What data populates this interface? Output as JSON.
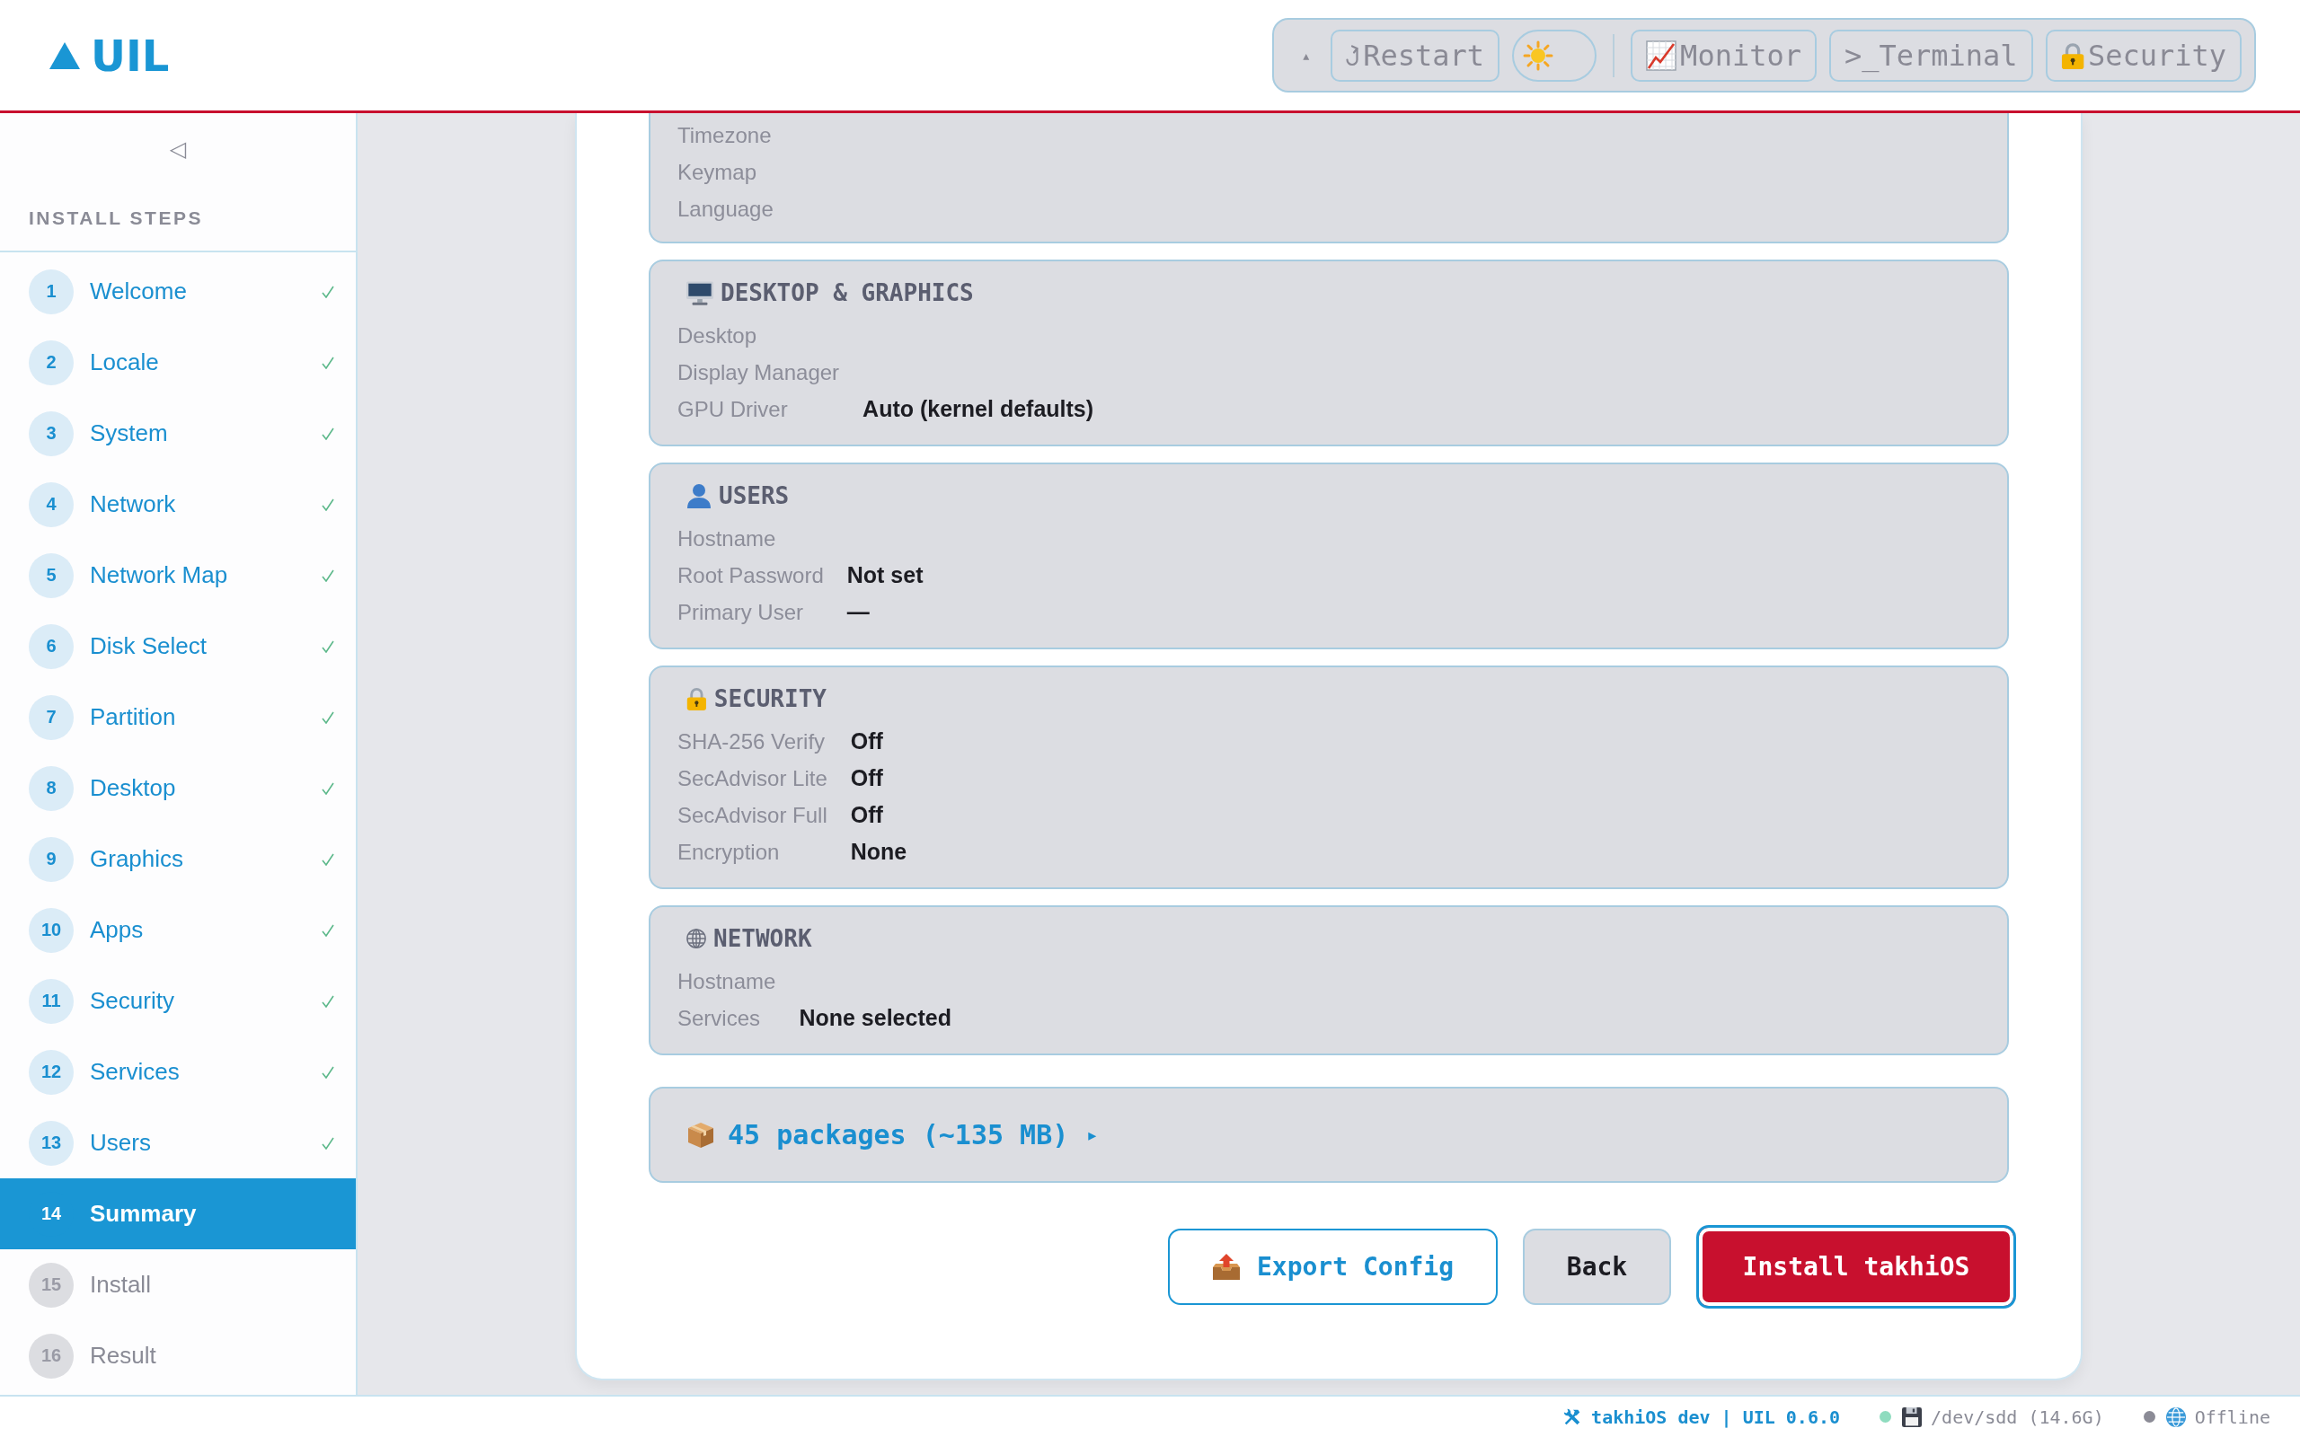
{
  "header": {
    "logo": "UIL",
    "toolbar": {
      "collapse_glyph": "▴",
      "items": [
        {
          "kind": "restart",
          "label": "Restart"
        },
        {
          "kind": "theme_toggle",
          "dark": false
        },
        {
          "kind": "separator"
        },
        {
          "kind": "monitor",
          "label": "Monitor"
        },
        {
          "kind": "terminal",
          "label": ">_Terminal"
        },
        {
          "kind": "security",
          "label": "Security"
        }
      ]
    }
  },
  "sidebar": {
    "collapse_glyph": "◁",
    "title": "INSTALL STEPS",
    "steps": [
      {
        "number": "1",
        "label": "Welcome",
        "done": true,
        "selected": false
      },
      {
        "number": "2",
        "label": "Locale",
        "done": true,
        "selected": false
      },
      {
        "number": "3",
        "label": "System",
        "done": true,
        "selected": false
      },
      {
        "number": "4",
        "label": "Network",
        "done": true,
        "selected": false
      },
      {
        "number": "5",
        "label": "Network Map",
        "done": true,
        "selected": false
      },
      {
        "number": "6",
        "label": "Disk Select",
        "done": true,
        "selected": false
      },
      {
        "number": "7",
        "label": "Partition",
        "done": true,
        "selected": false
      },
      {
        "number": "8",
        "label": "Desktop",
        "done": true,
        "selected": false
      },
      {
        "number": "9",
        "label": "Graphics",
        "done": true,
        "selected": false
      },
      {
        "number": "10",
        "label": "Apps",
        "done": true,
        "selected": false
      },
      {
        "number": "11",
        "label": "Security",
        "done": true,
        "selected": false
      },
      {
        "number": "12",
        "label": "Services",
        "done": true,
        "selected": false
      },
      {
        "number": "13",
        "label": "Users",
        "done": true,
        "selected": false
      },
      {
        "number": "14",
        "label": "Summary",
        "done": false,
        "selected": true
      },
      {
        "number": "15",
        "label": "Install",
        "done": false,
        "selected": false
      },
      {
        "number": "16",
        "label": "Result",
        "done": false,
        "selected": false
      }
    ]
  },
  "summary": {
    "partial_section": {
      "rows": [
        {
          "label": "Timezone"
        },
        {
          "label": "Keymap"
        },
        {
          "label": "Language"
        }
      ]
    },
    "sections": [
      {
        "kind": "desktop",
        "heading": "DESKTOP & GRAPHICS",
        "rows": [
          {
            "label": "Desktop"
          },
          {
            "label": "Display Manager"
          },
          {
            "label": "GPU Driver",
            "value": "Auto (kernel defaults)"
          }
        ]
      },
      {
        "kind": "users",
        "heading": "USERS",
        "rows": [
          {
            "label": "Hostname"
          },
          {
            "label": "Root Password",
            "value": "Not set"
          },
          {
            "label": "Primary User",
            "value": "—"
          }
        ]
      },
      {
        "kind": "security",
        "heading": "SECURITY",
        "rows": [
          {
            "label": "SHA-256 Verify",
            "value": "Off"
          },
          {
            "label": "SecAdvisor Lite",
            "value": "Off"
          },
          {
            "label": "SecAdvisor Full",
            "value": "Off"
          },
          {
            "label": "Encryption",
            "value": "None"
          }
        ]
      },
      {
        "kind": "network",
        "heading": "NETWORK",
        "rows": [
          {
            "label": "Hostname"
          },
          {
            "label": "Services",
            "value": "None selected"
          }
        ]
      }
    ],
    "packages": {
      "label": "45 packages (~135 MB)",
      "expander": "▸"
    },
    "actions": [
      {
        "kind": "export",
        "label": "Export Config",
        "focused": false
      },
      {
        "kind": "back",
        "label": "Back",
        "focused": false
      },
      {
        "kind": "install",
        "label": "Install takhiOS",
        "focused": true
      }
    ]
  },
  "status_bar": {
    "items": [
      {
        "kind": "build",
        "label": "takhiOS dev | UIL 0.6.0"
      },
      {
        "kind": "disk",
        "label": "/dev/sdd (14.6G)",
        "color": "#8fdcbf"
      },
      {
        "kind": "network",
        "label": "Offline",
        "color": "#8b8b96"
      }
    ]
  }
}
